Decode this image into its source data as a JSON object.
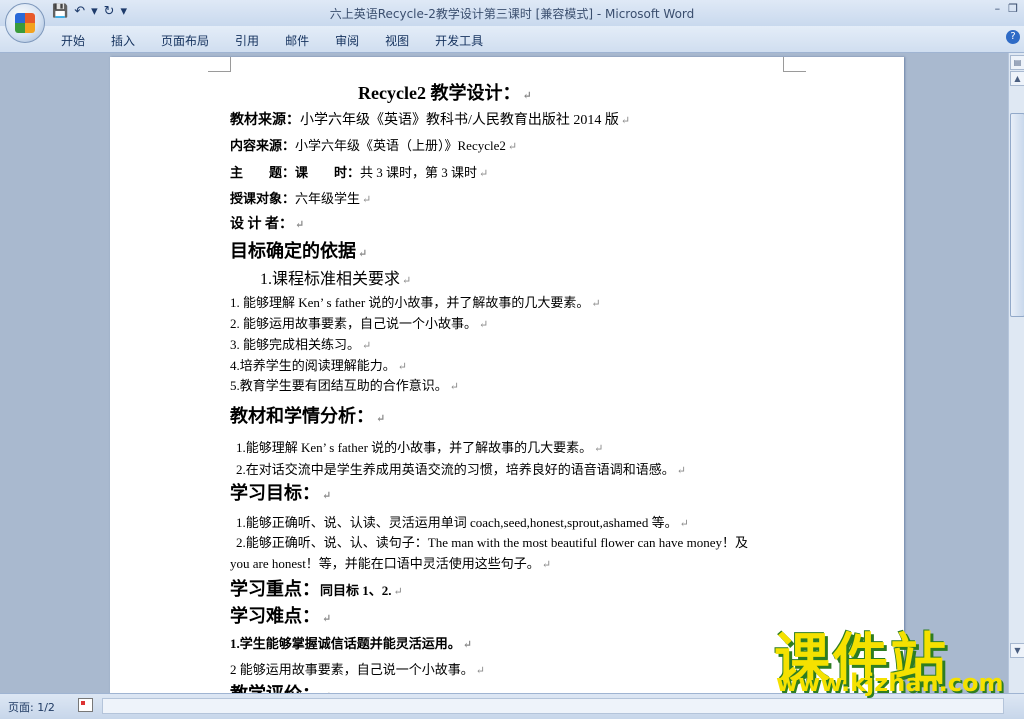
{
  "window": {
    "title": "六上英语Recycle-2教学设计第三课时 [兼容模式] - Microsoft Word",
    "controls": [
      "–",
      "❐"
    ]
  },
  "quick_access": [
    "💾",
    "↶",
    "▾",
    "↻",
    "▾"
  ],
  "ribbon_tabs": [
    "开始",
    "插入",
    "页面布局",
    "引用",
    "邮件",
    "审阅",
    "视图",
    "开发工具"
  ],
  "document": {
    "title": "Recycle2 教学设计：",
    "source1_label": "教材来源：",
    "source1_text": "小学六年级《英语》教科书/人民教育出版社 2014 版",
    "source2_label": "内容来源：",
    "source2_text": "小学六年级《英语（上册）》Recycle2",
    "topic_label": "主　　题：课　　时：",
    "topic_text": "共 3 课时，第 3 课时",
    "audience_label": "授课对象：",
    "audience_text": "六年级学生",
    "designer_label": "设 计 者：",
    "h_basis": "目标确定的依据",
    "h_basis_sub": "1.课程标准相关要求",
    "basis_items": [
      "1.  能够理解 Ken’ s father 说的小故事，并了解故事的几大要素。",
      "2.  能够运用故事要素，自己说一个小故事。",
      "3.  能够完成相关练习。",
      "4.培养学生的阅读理解能力。",
      "5.教育学生要有团结互助的合作意识。"
    ],
    "h_analysis": "教材和学情分析：",
    "analysis_items": [
      "1.能够理解 Ken’ s father 说的小故事，并了解故事的几大要素。",
      "2.在对话交流中是学生养成用英语交流的习惯，培养良好的语音语调和语感。"
    ],
    "h_goals": "学习目标：",
    "goal1": "1.能够正确听、说、认读、灵活运用单词 coach,seed,honest,sprout,ashamed 等。",
    "goal2a": "2.能够正确听、说、认、读句子：The man with the most beautiful flower can have money！及",
    "goal2b": "you are honest！等，并能在口语中灵活使用这些句子。",
    "h_key": "学习重点：",
    "key_text": "同目标 1、2.",
    "h_diff": "学习难点：",
    "diff1": "1.学生能够掌握诚信话题并能灵活运用。",
    "diff2": "2 能够运用故事要素，自己说一个小故事。",
    "h_eval": "教学评价："
  },
  "status": {
    "page_label": "页面: 1/2"
  },
  "watermark": {
    "big": "课件站",
    "url": "www.kjzhan.com"
  }
}
